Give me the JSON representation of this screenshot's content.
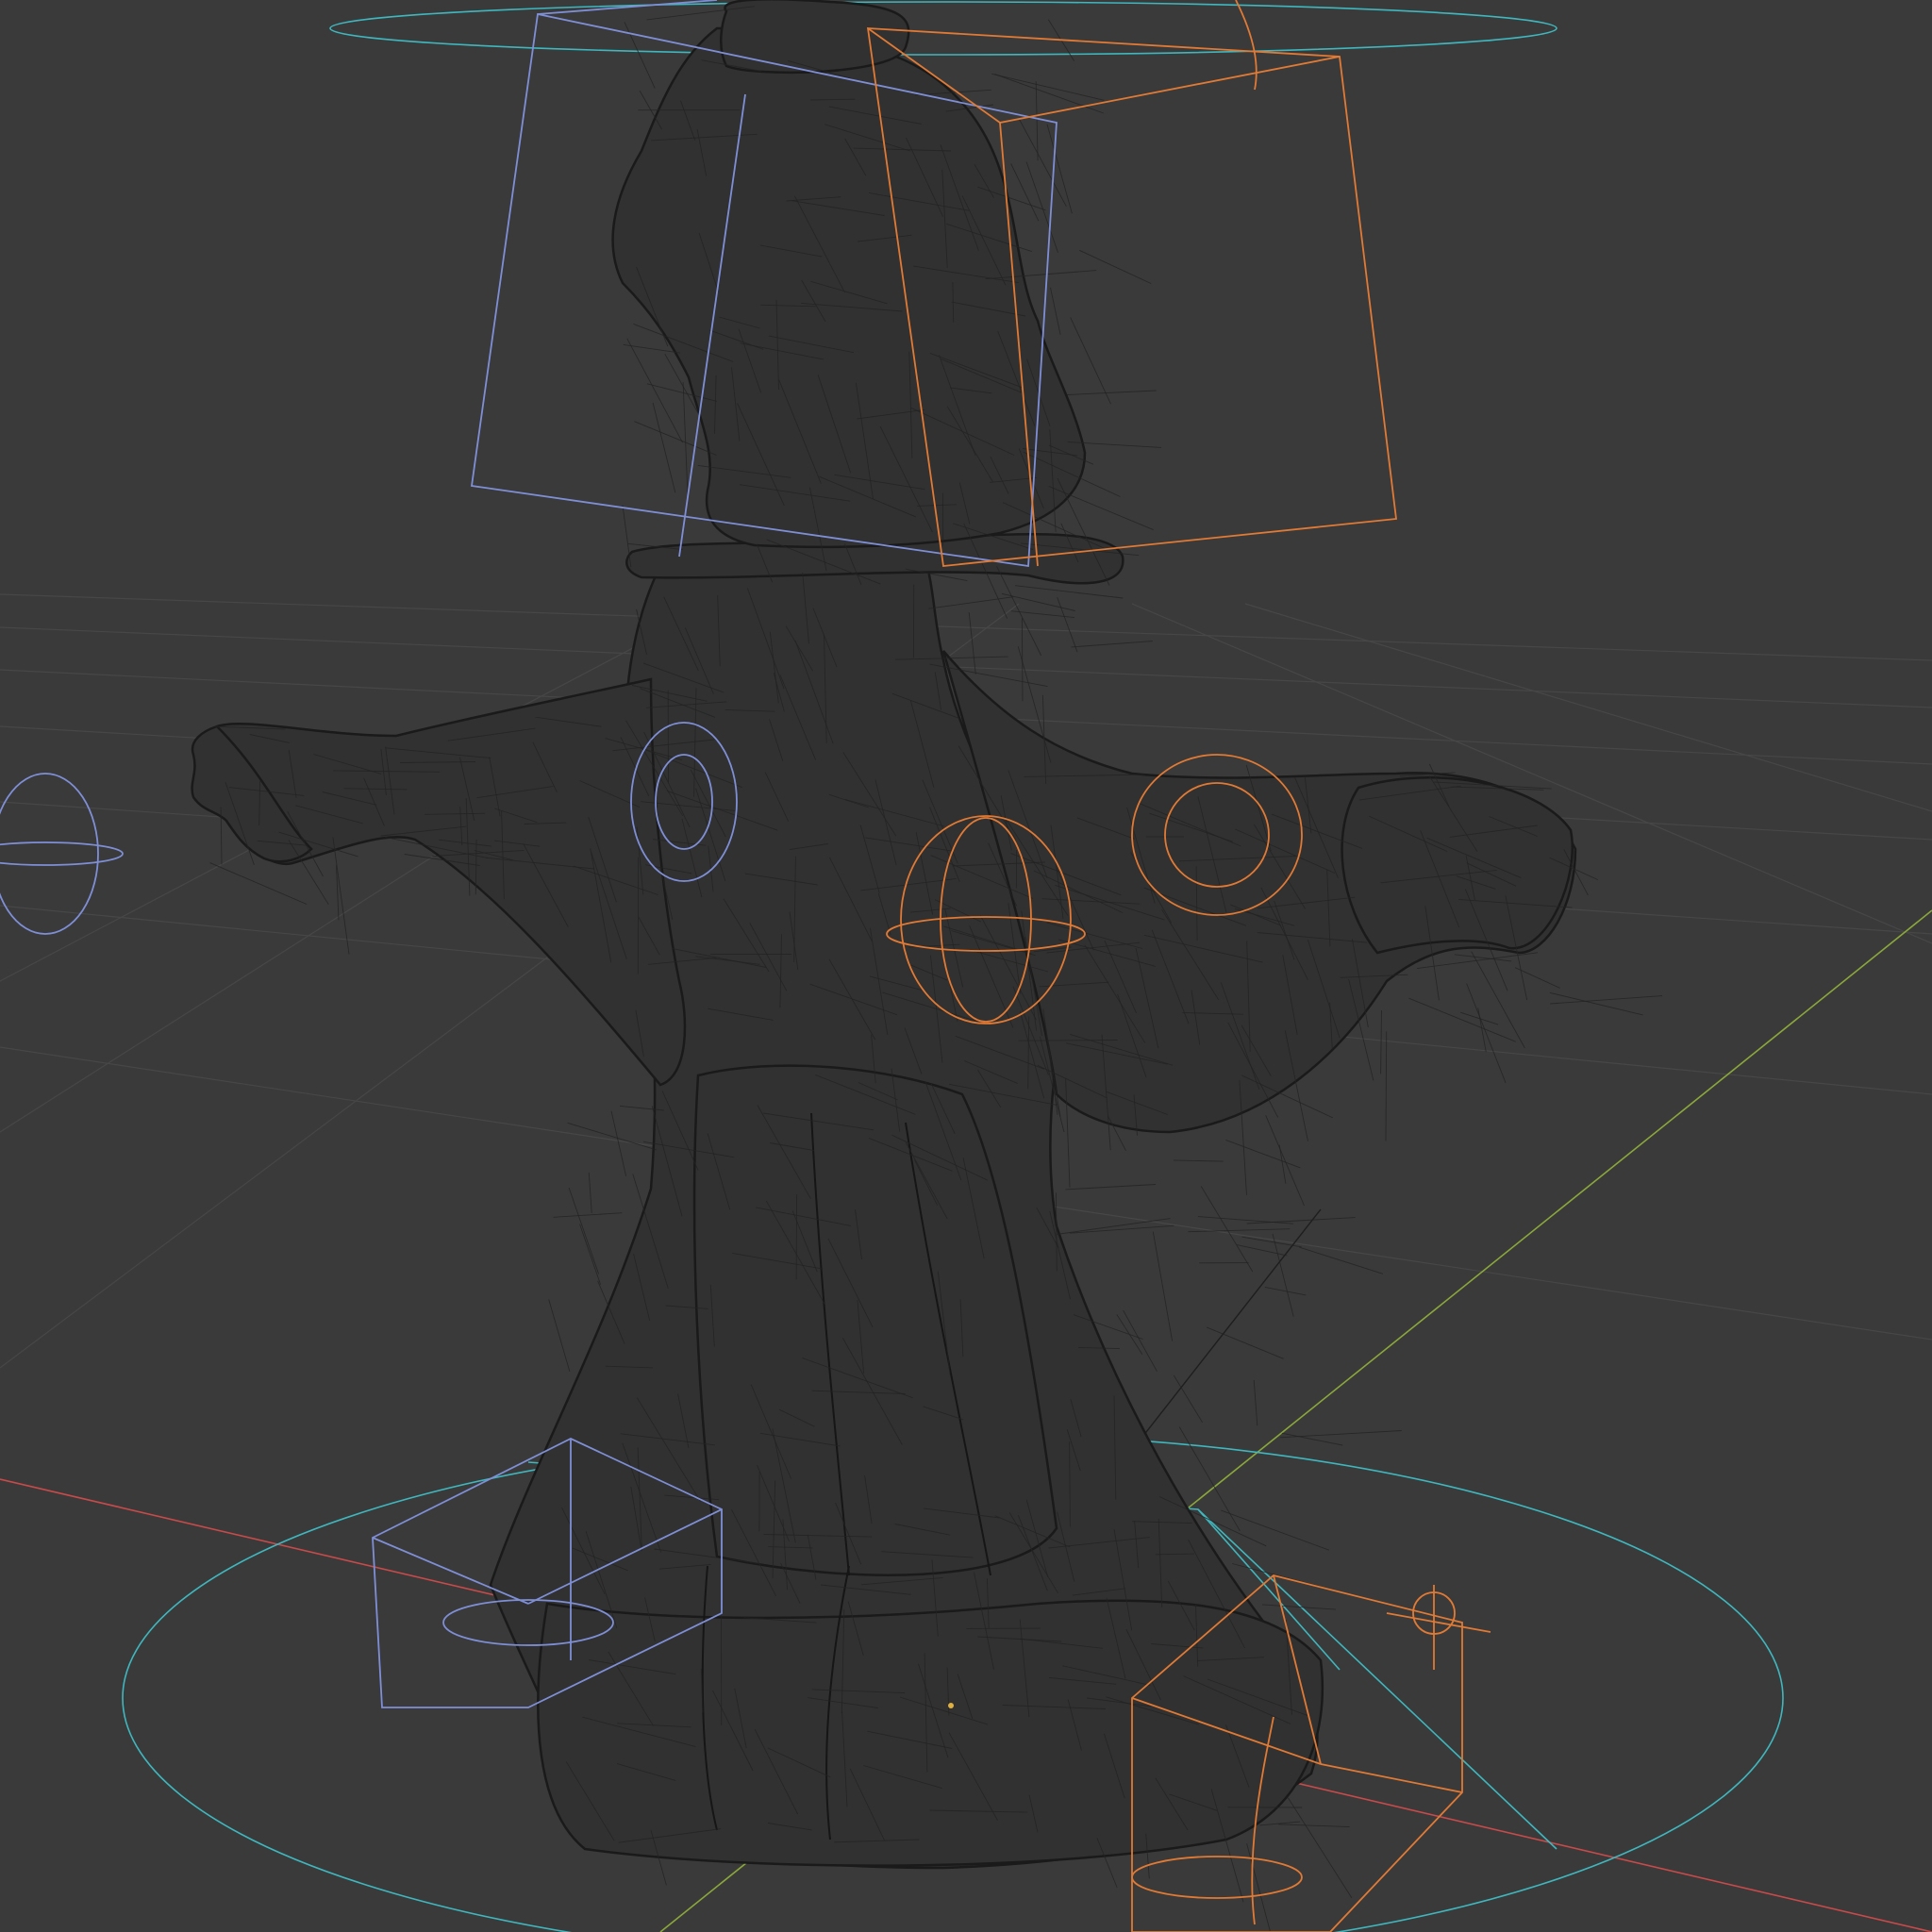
{
  "viewport": {
    "mode": "wireframe",
    "background_color": "#3a3a3a",
    "grid_color": "#474747"
  },
  "axes": {
    "x_axis_color": "#c84a4a",
    "y_axis_color": "#8aa83a"
  },
  "mesh": {
    "name": "character-mesh",
    "wire_color": "#161616"
  },
  "rig_colors": {
    "left_side": "#7f8fd6",
    "right_side": "#e07a35",
    "root": "#3fb7be"
  },
  "controls": [
    {
      "kind": "box",
      "side": "left",
      "region": "head"
    },
    {
      "kind": "box",
      "side": "right",
      "region": "head"
    },
    {
      "kind": "sphere",
      "side": "left",
      "region": "hand"
    },
    {
      "kind": "sphere",
      "side": "right",
      "region": "torso"
    },
    {
      "kind": "circle",
      "side": "left",
      "region": "chest"
    },
    {
      "kind": "circle",
      "side": "right",
      "region": "arm"
    },
    {
      "kind": "box",
      "side": "left",
      "region": "foot"
    },
    {
      "kind": "box",
      "side": "right",
      "region": "foot"
    },
    {
      "kind": "circle",
      "side": "root",
      "region": "base"
    }
  ]
}
